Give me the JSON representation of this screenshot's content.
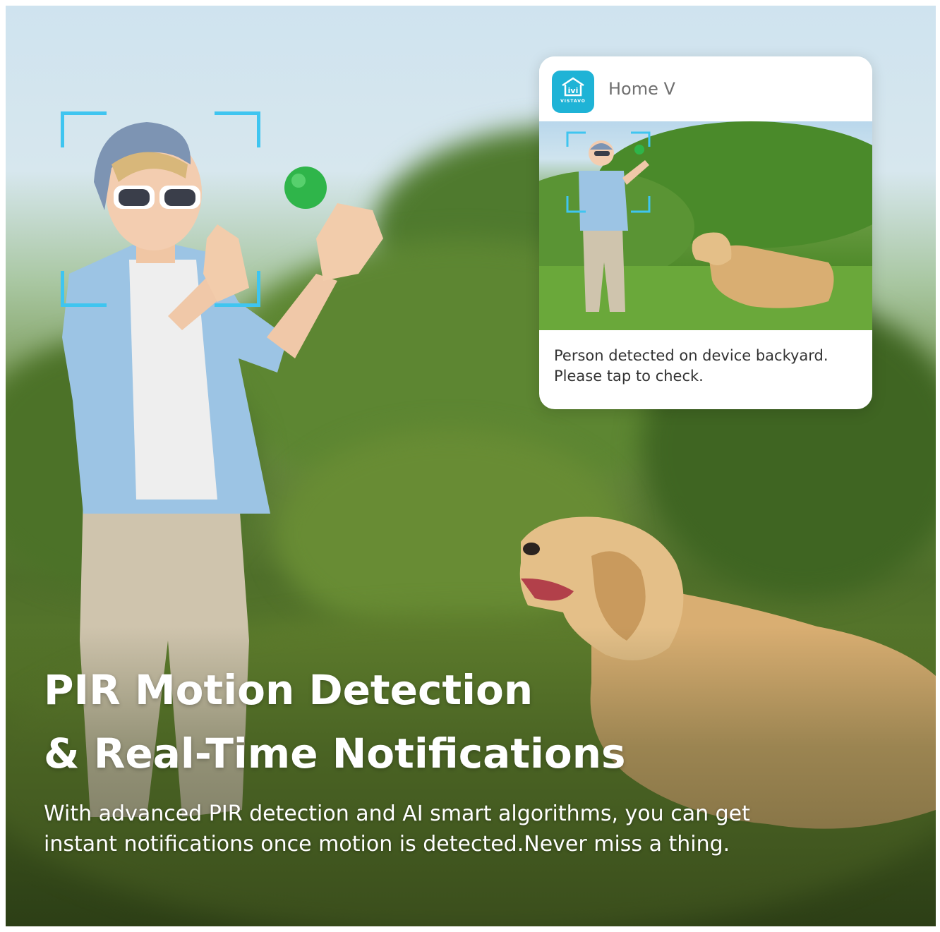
{
  "notification": {
    "app_icon": "vistavo-home-logo",
    "app_logo_letters": "ivi",
    "app_logo_word": "VISTAVO",
    "app_name": "Home V",
    "message_line1": "Person detected on device backyard.",
    "message_line2": "Please tap to check."
  },
  "headline": {
    "line1": "PIR Motion Detection",
    "line2": "& Real-Time Notifications"
  },
  "description": {
    "line1": "With advanced PIR detection and AI smart algorithms, you can get",
    "line2": "instant notifications once motion is detected.Never miss a thing."
  },
  "colors": {
    "detection_frame": "#3fc5f0",
    "app_icon_bg": "#1fb3d6",
    "headline_text": "#ffffff"
  }
}
